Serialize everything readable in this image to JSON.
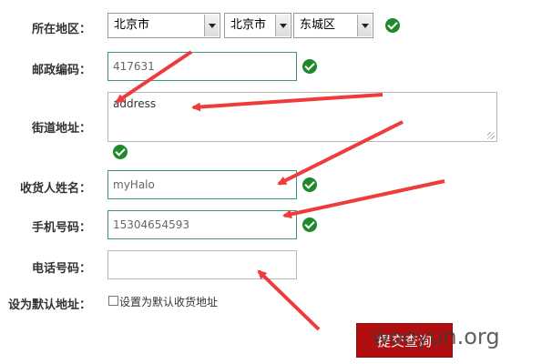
{
  "form": {
    "region": {
      "label": "所在地区：",
      "province": "北京市",
      "city": "北京市",
      "district": "东城区"
    },
    "postcode": {
      "label": "邮政编码：",
      "value": "417631"
    },
    "street": {
      "label": "街道地址：",
      "value": "address"
    },
    "name": {
      "label": "收货人姓名：",
      "value": "myHalo"
    },
    "mobile": {
      "label": "手机号码：",
      "value": "15304654593"
    },
    "phone": {
      "label": "电话号码：",
      "value": ""
    },
    "default": {
      "label": "设为默认地址：",
      "checkbox_label": "设置为默认收货地址"
    },
    "submit_label": "提交查询"
  },
  "watermark": "wooyun.org",
  "colors": {
    "valid": "#1f8a2a",
    "submit": "#b10f0f",
    "arrow": "#ef3b3b",
    "field_border_valid": "#3a9a78"
  },
  "icons": {
    "valid": "check-circle-icon"
  }
}
